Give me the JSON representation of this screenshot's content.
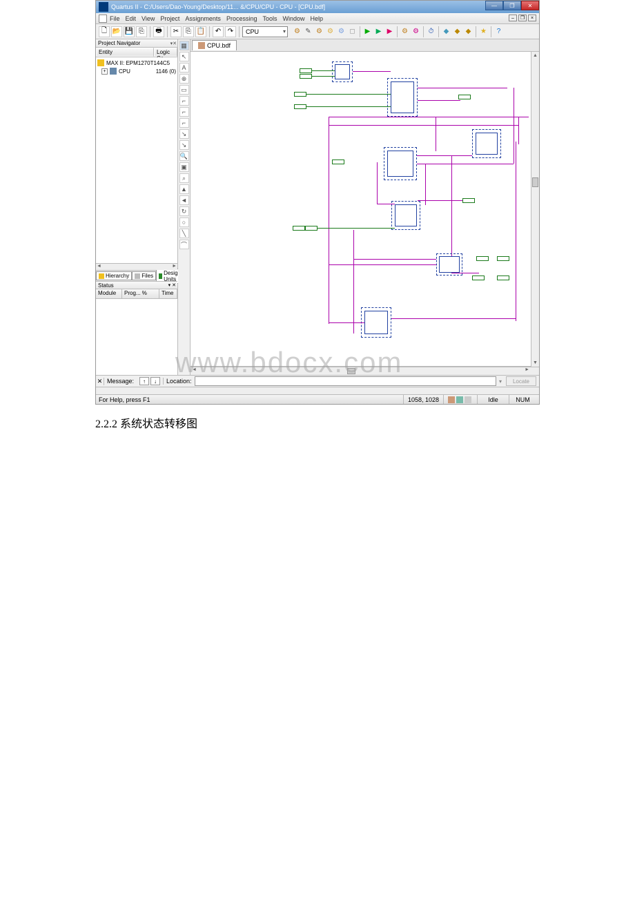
{
  "titlebar": {
    "title": "Quartus II - C:/Users/Dao-Young/Desktop/11... &/CPU/CPU - CPU - [CPU.bdf]",
    "min": "—",
    "max": "❐",
    "close": "✕"
  },
  "menu": {
    "file": "File",
    "edit": "Edit",
    "view": "View",
    "project": "Project",
    "assignments": "Assignments",
    "processing": "Processing",
    "tools": "Tools",
    "window": "Window",
    "help": "Help",
    "mdi_min": "–",
    "mdi_restore": "❐",
    "mdi_close": "×"
  },
  "toolbar": {
    "dropdown": "CPU"
  },
  "left": {
    "nav_title": "Project Navigator",
    "nav_pin": "▾ ✕",
    "col_entity": "Entity",
    "col_logic": "Logic Ce",
    "dev": "MAX II: EPM1270T144C5",
    "root": "CPU",
    "root_val": "1146 (0)",
    "tab_hierarchy": "Hierarchy",
    "tab_files": "Files",
    "tab_design": "Design Units",
    "status_title": "Status",
    "status_pin": "▾ ✕",
    "status_c1": "Module",
    "status_c2": "Prog... %",
    "status_c3": "Time "
  },
  "file_tab": "CPU.bdf",
  "msg": {
    "x": "✕",
    "label": "Message:",
    "up": "↑",
    "dn": "↓",
    "loc": "Location:",
    "locate_btn": "Locate"
  },
  "status": {
    "help": "For Help, press F1",
    "coords": "1058, 1028",
    "idle": "Idle",
    "num": "NUM"
  },
  "watermark": "www.bdocx.com",
  "caption": "2.2.2 系统状态转移图"
}
